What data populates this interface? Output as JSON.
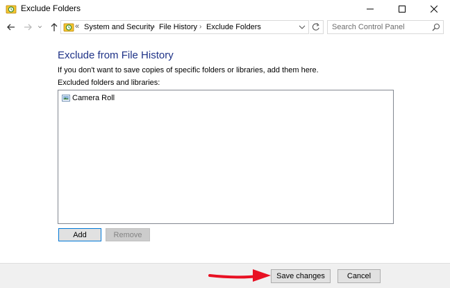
{
  "window": {
    "title": "Exclude Folders"
  },
  "nav": {
    "breadcrumb": [
      "System and Security",
      "File History",
      "Exclude Folders"
    ],
    "overflow_glyph": "«",
    "search_placeholder": "Search Control Panel"
  },
  "main": {
    "heading": "Exclude from File History",
    "description": "If you don't want to save copies of specific folders or libraries, add them here.",
    "list_label": "Excluded folders and libraries:",
    "items": [
      {
        "label": "Camera Roll",
        "icon": "pictures-library-icon"
      }
    ],
    "add_label": "Add",
    "remove_label": "Remove"
  },
  "footer": {
    "save_label": "Save changes",
    "cancel_label": "Cancel"
  },
  "colors": {
    "heading": "#1e3287",
    "arrow": "#e81123",
    "focus_border": "#0078d7",
    "footer_bg": "#f0f0f0"
  }
}
